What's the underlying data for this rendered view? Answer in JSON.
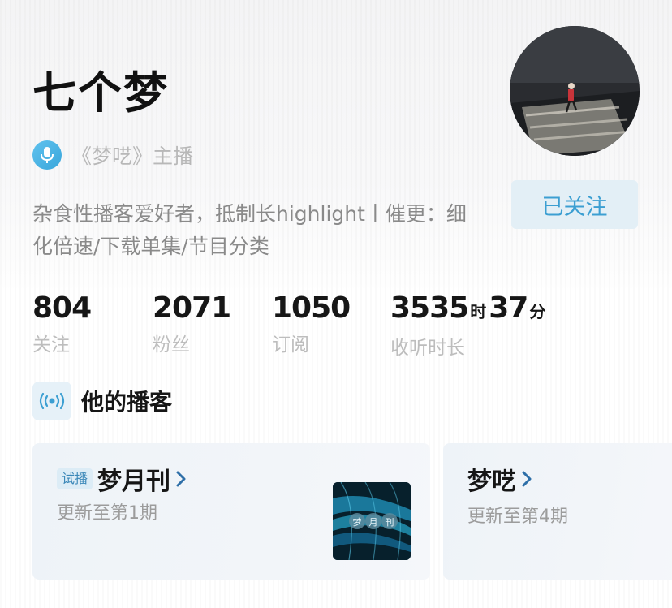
{
  "profile": {
    "name": "七个梦",
    "host_role": "《梦呓》主播",
    "bio": "杂食性播客爱好者，抵制长highlight丨催更：细化倍速/下载单集/节目分类",
    "follow_button_label": "已关注"
  },
  "stats": {
    "following": {
      "value": "804",
      "label": "关注"
    },
    "followers": {
      "value": "2071",
      "label": "粉丝"
    },
    "subscriptions": {
      "value": "1050",
      "label": "订阅"
    },
    "listen_time": {
      "hours": "3535",
      "hours_unit": "时",
      "minutes": "37",
      "minutes_unit": "分",
      "label": "收听时长"
    }
  },
  "section": {
    "title": "他的播客"
  },
  "podcasts": [
    {
      "badge": "试播",
      "title": "梦月刊",
      "update": "更新至第1期",
      "cover_text": "梦月刊"
    },
    {
      "title": "梦呓",
      "update": "更新至第4期"
    }
  ],
  "icons": {
    "host": "microphone-icon",
    "section": "broadcast-icon",
    "chevron": "chevron-right-icon"
  },
  "colors": {
    "accent": "#3c9fd2",
    "follow_button_bg": "#e3eff6",
    "chevron": "#2e6fa8"
  }
}
